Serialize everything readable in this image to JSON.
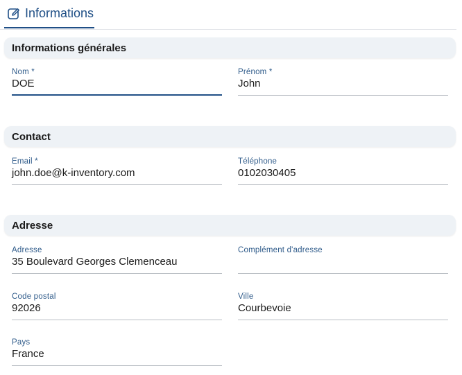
{
  "tab": {
    "label": "Informations",
    "icon": "edit-icon",
    "color": "#1f4f86"
  },
  "sections": {
    "general": {
      "title": "Informations générales",
      "fields": {
        "nom": {
          "label": "Nom *",
          "value": "DOE"
        },
        "prenom": {
          "label": "Prénom *",
          "value": "John"
        }
      }
    },
    "contact": {
      "title": "Contact",
      "fields": {
        "email": {
          "label": "Email *",
          "value": "john.doe@k-inventory.com"
        },
        "telephone": {
          "label": "Téléphone",
          "value": "0102030405"
        }
      }
    },
    "adresse": {
      "title": "Adresse",
      "fields": {
        "adresse": {
          "label": "Adresse",
          "value": "35 Boulevard Georges Clemenceau"
        },
        "complement": {
          "label": "Complément d'adresse",
          "value": ""
        },
        "code_postal": {
          "label": "Code postal",
          "value": "92026"
        },
        "ville": {
          "label": "Ville",
          "value": "Courbevoie"
        },
        "pays": {
          "label": "Pays",
          "value": "France"
        }
      }
    }
  }
}
